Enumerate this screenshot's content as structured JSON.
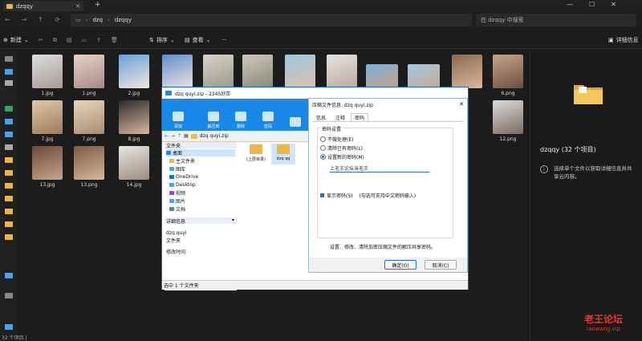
{
  "window": {
    "tab_title": "dzqqy"
  },
  "address": {
    "crumb1": "dzq",
    "crumb2": "dzqqy",
    "search_placeholder": "在 dzqqy 中搜索"
  },
  "toolbar": {
    "new": "新建",
    "sort": "排序",
    "view": "查看",
    "details": "详细信息"
  },
  "files_row1": [
    "1.jpg",
    "1.png",
    "2.jpg",
    "6.png"
  ],
  "files_row2": [
    "7.jpg",
    "7.png",
    "8.jpg",
    "12.png"
  ],
  "files_row3": [
    "13.jpg",
    "13.png",
    "14.jpg"
  ],
  "details_pane": {
    "title": "dzqqy (32 个项目)",
    "hint": "选择单个文件以获取详细信息并共享云内容。"
  },
  "status_left": "32 个项目 |",
  "zip_window": {
    "title": "dzq quyi.zip - 2345好压",
    "ribbon": [
      "添加",
      "解压到",
      "删除",
      "密码"
    ],
    "path": "dzq quyi.zip",
    "tree_header": "文件夹",
    "tree": [
      "桌面",
      "主文件夹",
      "图库",
      "OneDrive",
      "Desktop",
      "视频",
      "图片",
      "文档"
    ],
    "detail_header": "详细信息",
    "detail_name": "dzq quyi",
    "detail_type": "文件夹",
    "detail_modified": "修改时间:",
    "files": [
      "(上层目录)",
      "dzq qq"
    ],
    "status": "选中 1 个文件夹"
  },
  "dialog": {
    "title": "压缩文件信息: dzq quyi.zip",
    "tabs": [
      "信息",
      "注释",
      "密码"
    ],
    "group_label": "密码设置",
    "opt1": "不做处理(E)",
    "opt2": "清除已有密码(L)",
    "opt3": "设置新的密码(M)",
    "password": "上毛王论坛当毛王",
    "show_pwd": "显示密码(S)",
    "show_note": "(勾选可支持中文密码输入)",
    "footer": "设置、修改、清除加密压缩文件的解压共享密码。",
    "ok": "确定(O)",
    "cancel": "取消(C)"
  },
  "watermark": {
    "line1": "老王论坛",
    "line2": "laowang.vip"
  },
  "colors": {
    "accent": "#1a88e8",
    "folder": "#e8b84a"
  }
}
